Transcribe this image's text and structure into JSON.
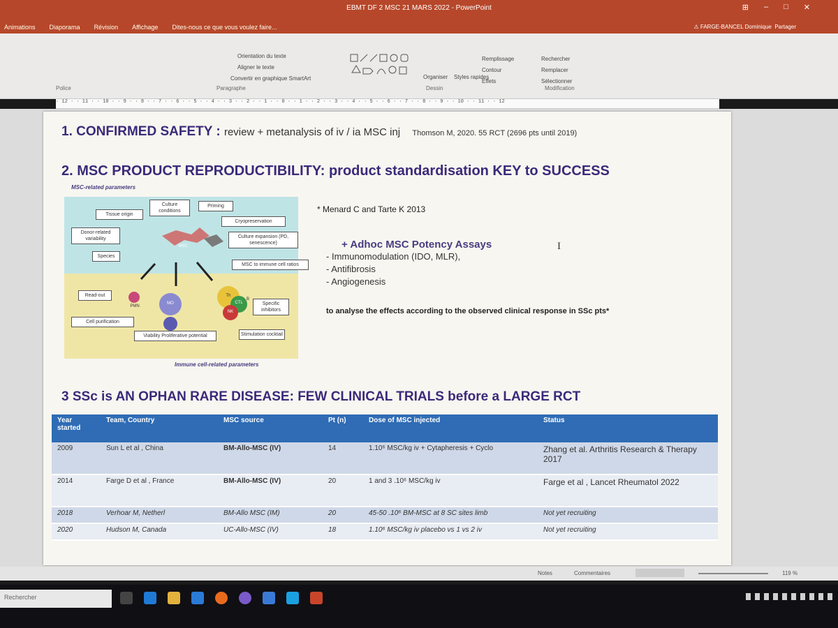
{
  "window": {
    "title": "EBMT DF 2 MSC 21 MARS 2022 - PowerPoint",
    "tabs": [
      "Animations",
      "Diaporama",
      "Révision",
      "Affichage",
      "Dites-nous ce que vous voulez faire..."
    ],
    "user": "FARGE-BANCEL Dominique",
    "share": "Partager"
  },
  "ribbon": {
    "groups": [
      "Police",
      "Paragraphe",
      "Dessin",
      "Modification"
    ],
    "items": [
      "Orientation du texte",
      "Aligner le texte",
      "Convertir en graphique SmartArt",
      "Organiser",
      "Styles rapides",
      "Remplissage",
      "Contour",
      "Effets",
      "Rechercher",
      "Remplacer",
      "Sélectionner"
    ]
  },
  "ruler": "· 12 · · 11 · · 10 · · 9 · · 8 · · 7 · · 6 · · 5 · · 4 · · 3 · · 2 · · 1 · · 0 · · 1 · · 2 · · 3 · · 4 · · 5 · · 6 · · 7 · · 8 · · 9 · · 10 · · 11 · · 12",
  "slide": {
    "s1_title": "1. CONFIRMED SAFETY :",
    "s1_text": "review + metanalysis of iv / ia MSC inj",
    "s1_ref": "Thomson M, 2020. 55 RCT (2696 pts until 2019)",
    "s2_title": "2. MSC PRODUCT REPRODUCTIBILITY:  product standardisation KEY to SUCCESS",
    "diagram": {
      "top_label": "MSC-related parameters",
      "bottom_label": "Immune cell-related parameters",
      "boxes": [
        "Tissue origin",
        "Culture conditions",
        "Priming",
        "Cryopreservation",
        "Donor-related variability",
        "Culture expansion (PD, senescence)",
        "Species",
        "MSC to immune cell ratios",
        "Read-out",
        "Cell purification",
        "Viability Proliferative potential",
        "Specific inhibitors",
        "Stimulation cocktail"
      ],
      "cells": [
        "MSC",
        "PMN",
        "MO",
        "Th",
        "CTL",
        "B",
        "NK"
      ]
    },
    "menard": "* Menard C and Tarte K 2013",
    "adhoc": "+ Adhoc MSC Potency Assays",
    "bullets": [
      "Immunomodulation (IDO, MLR),",
      "Antifibrosis",
      "Angiogenesis"
    ],
    "analyse": "to analyse the effects according to the observed clinical response in SSc pts*",
    "s3_title": "3 SSc is AN OPHAN RARE DISEASE: FEW CLINICAL TRIALS before a LARGE RCT",
    "table": {
      "headers": [
        "Year started",
        "Team, Country",
        "MSC source",
        "Pt (n)",
        "Dose of MSC injected",
        "Status"
      ],
      "rows": [
        [
          "2009",
          "Sun L et al , China",
          "BM-Allo-MSC (IV)",
          "14",
          "1.10⁶ MSC/kg iv + Cytapheresis + Cyclo",
          "Zhang et al. Arthritis Research & Therapy 2017"
        ],
        [
          "2014",
          "Farge D et al , France",
          "BM-Allo-MSC (IV)",
          "20",
          "1 and 3 .10⁶ MSC/kg iv",
          "Farge et al , Lancet Rheumatol 2022"
        ],
        [
          "2018",
          "Verhoar M, Netherl",
          "BM-Allo MSC (IM)",
          "20",
          "45-50 .10⁶ BM-MSC at 8 SC sites limb",
          "Not yet recruiting"
        ],
        [
          "2020",
          "Hudson M, Canada",
          "UC-Allo-MSC (IV)",
          "18",
          "1.10⁶ MSC/kg iv placebo vs 1 vs 2 iv",
          "Not yet recruiting"
        ]
      ]
    }
  },
  "statusbar": {
    "notes": "Notes",
    "comments": "Commentaires",
    "zoom": "119 %"
  },
  "taskbar": {
    "search": "Rechercher"
  }
}
